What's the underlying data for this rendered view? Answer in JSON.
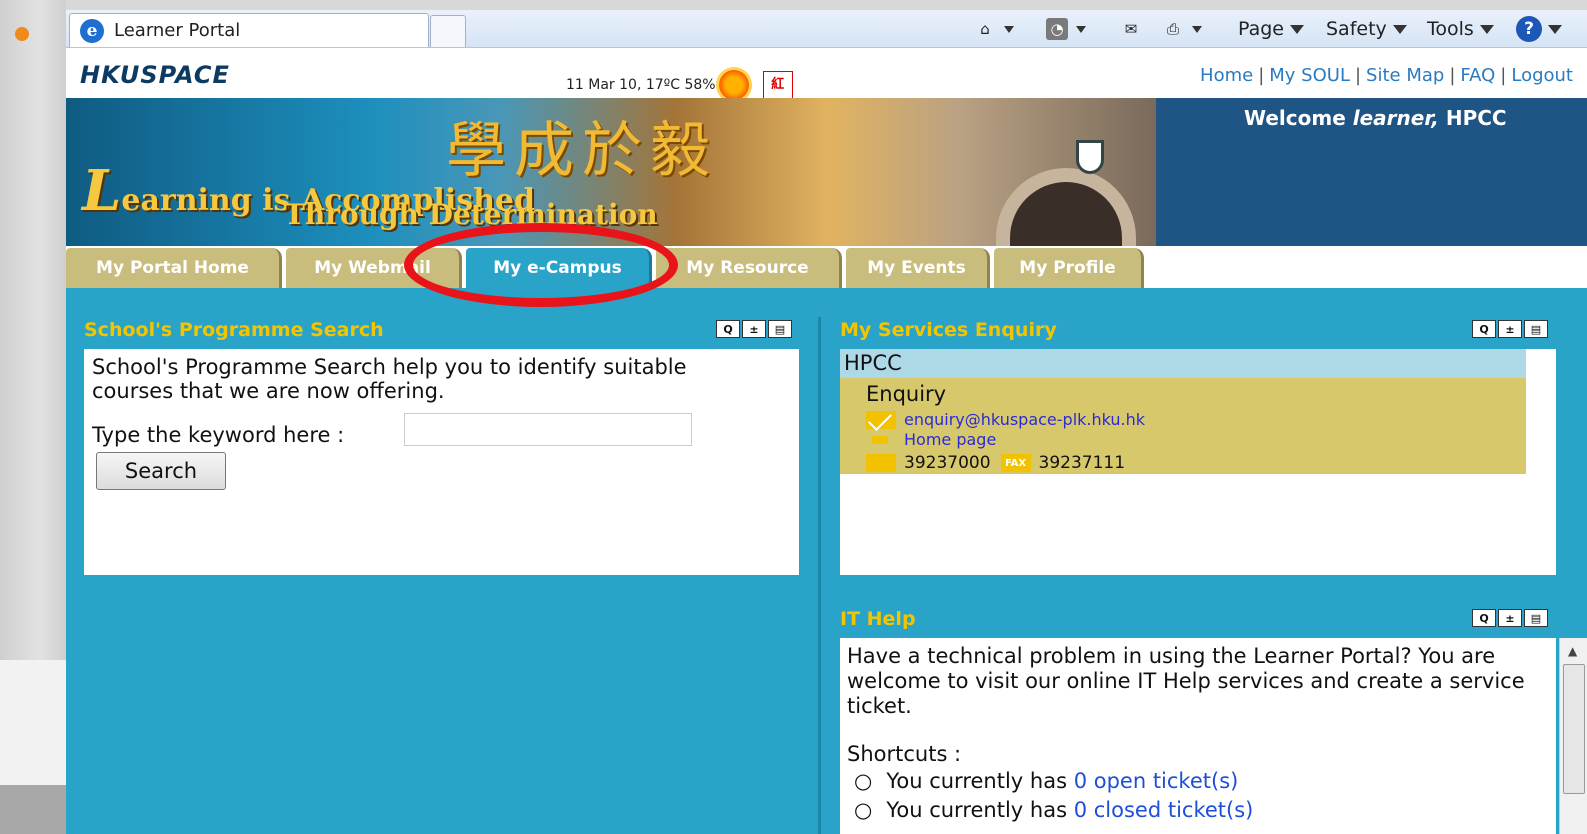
{
  "browser": {
    "tab_title": "Learner Portal",
    "commands": {
      "page": "Page",
      "safety": "Safety",
      "tools": "Tools"
    }
  },
  "header": {
    "logo": "HKUSPACE",
    "weather": "11 Mar 10, 17ºC 58%",
    "warning_label": "紅",
    "links": [
      "Home",
      "My SOUL",
      "Site Map",
      "FAQ",
      "Logout"
    ]
  },
  "banner": {
    "chinese_slogan": "學成於毅",
    "slogan_line1_initial": "L",
    "slogan_line1_rest": "earning is Accomplished",
    "slogan_line2": "Through Determination"
  },
  "welcome": {
    "prefix": "Welcome",
    "user": "learner,",
    "org": "HPCC"
  },
  "nav": {
    "tabs": [
      "My Portal Home",
      "My Webmail",
      "My e-Campus",
      "My Resource",
      "My Events",
      "My Profile"
    ],
    "active": "My e-Campus"
  },
  "programme_search": {
    "title": "School's Programme Search",
    "description": "School's Programme Search help you to identify suitable courses that we are now offering.",
    "keyword_label": "Type the keyword here :",
    "keyword_value": "",
    "search_button": "Search"
  },
  "services": {
    "title": "My Services Enquiry",
    "org": "HPCC",
    "section": "Enquiry",
    "email": "enquiry@hkuspace-plk.hku.hk",
    "homepage": "Home page",
    "phone": "39237000",
    "fax_label": "FAX",
    "fax": "39237111"
  },
  "it_help": {
    "title": "IT Help",
    "description": "Have a technical problem in using the Learner Portal? You are welcome to visit our online IT Help services and create a service ticket.",
    "shortcuts_label": "Shortcuts :",
    "item1_prefix": "You currently has",
    "item1_link": "0 open ticket(s)",
    "item2_prefix": "You currently has",
    "item2_link": "0 closed ticket(s)"
  },
  "colors": {
    "portal_bg": "#2aa3c8",
    "tab_inactive": "#c9bd7d",
    "portlet_title": "#f3c500",
    "welcome_bg": "#1e5584",
    "highlight": "#e8141a"
  },
  "icons": [
    "internet-explorer-icon",
    "home-icon",
    "rss-feed-icon",
    "read-mail-icon",
    "print-icon",
    "help-icon",
    "sun-weather-icon",
    "red-rainstorm-warning-icon",
    "email-icon",
    "homepage-icon",
    "phone-icon",
    "fax-icon",
    "portlet-search-icon",
    "portlet-minimize-icon",
    "portlet-maximize-icon"
  ]
}
